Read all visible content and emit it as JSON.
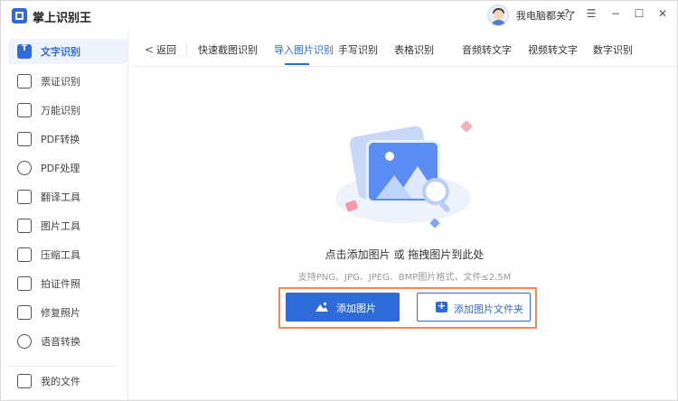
{
  "app": {
    "title": "掌上识别王",
    "user_name": "我电脑都关了"
  },
  "window_controls": {
    "help": "?",
    "menu": "☰",
    "minimize": "−",
    "maximize": "☐",
    "close": "✕"
  },
  "sidebar": {
    "items": [
      {
        "label": "文字识别",
        "icon": "text-recognition-icon",
        "active": true
      },
      {
        "label": "票证识别",
        "icon": "ticket-icon"
      },
      {
        "label": "万能识别",
        "icon": "universal-scan-icon"
      },
      {
        "label": "PDF转换",
        "icon": "pdf-convert-icon"
      },
      {
        "label": "PDF处理",
        "icon": "pdf-process-icon"
      },
      {
        "label": "翻译工具",
        "icon": "translate-icon"
      },
      {
        "label": "图片工具",
        "icon": "image-tools-icon"
      },
      {
        "label": "压缩工具",
        "icon": "compress-icon"
      },
      {
        "label": "拍证件照",
        "icon": "id-photo-icon"
      },
      {
        "label": "修复照片",
        "icon": "photo-repair-icon"
      },
      {
        "label": "语音转换",
        "icon": "voice-convert-icon"
      }
    ],
    "footer_label": "我的文件"
  },
  "tabs": {
    "back_label": "返回",
    "items": [
      {
        "label": "快速截图识别"
      },
      {
        "label": "导入图片识别",
        "active": true
      },
      {
        "label": "手写识别"
      },
      {
        "label": "表格识别"
      },
      {
        "label": "音频转文字"
      },
      {
        "label": "视频转文字"
      },
      {
        "label": "数字识别"
      }
    ]
  },
  "upload": {
    "prompt": "点击添加图片 或 拖拽图片到此处",
    "formats": "支持PNG、JPG、JPEG、BMP图片格式，文件≤2.5M",
    "add_image_button": "添加图片",
    "add_folder_button": "添加图片文件夹"
  },
  "colors": {
    "accent": "#2f6bd8",
    "highlight_frame": "#f08a5d"
  }
}
